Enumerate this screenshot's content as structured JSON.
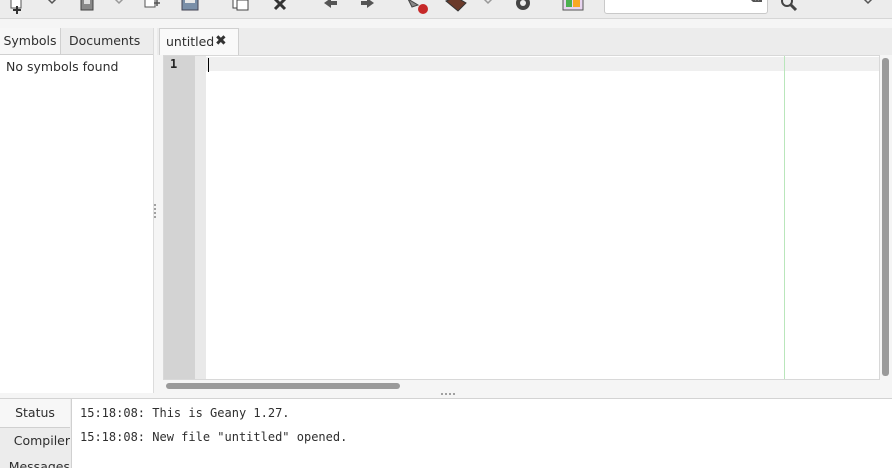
{
  "toolbar": {
    "icons": [
      "new-file-icon",
      "open-file-icon",
      "save-file-icon",
      "save-all-icon",
      "revert-icon",
      "close-file-icon",
      "navigate-back-icon",
      "navigate-forward-icon",
      "compile-icon",
      "build-icon",
      "run-icon",
      "color-chooser-icon",
      "search-icon",
      "overflow-chevron-icon"
    ],
    "search_value": ""
  },
  "sidebar": {
    "tabs": [
      "Symbols",
      "Documents"
    ],
    "active_tab": "Symbols",
    "empty_message": "No symbols found"
  },
  "editor": {
    "tabs": [
      {
        "label": "untitled",
        "close_glyph": "✖"
      }
    ],
    "line_numbers": [
      "1"
    ],
    "content": ""
  },
  "message_window": {
    "tabs": [
      "Status",
      "Compiler",
      "Messages"
    ],
    "active_tab": "Status",
    "log": [
      "15:18:08: This is Geany 1.27.",
      "15:18:08: New file \"untitled\" opened."
    ]
  }
}
